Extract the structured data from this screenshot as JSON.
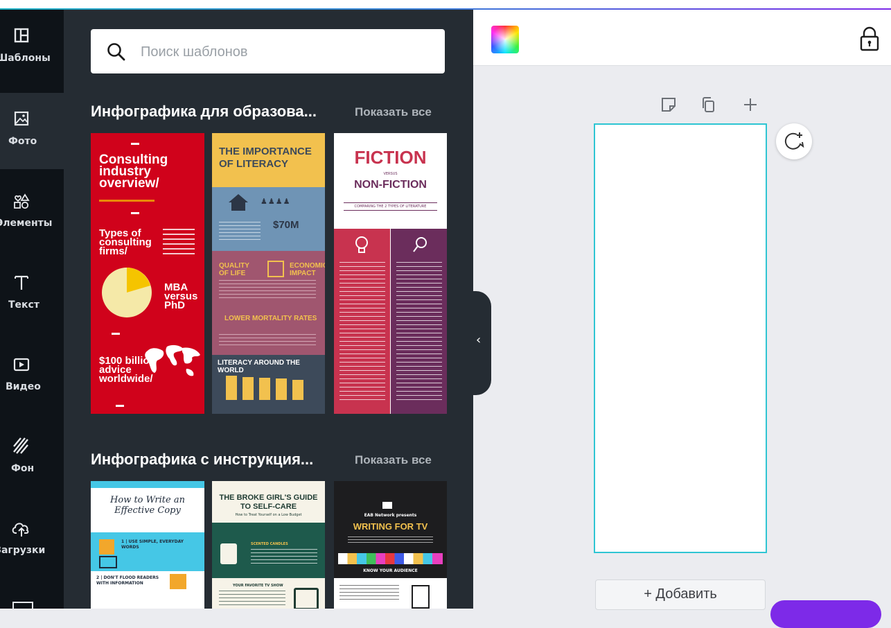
{
  "rail": {
    "items": [
      {
        "label": "Шаблоны",
        "icon": "templates-icon"
      },
      {
        "label": "Фото",
        "icon": "photo-icon"
      },
      {
        "label": "Элементы",
        "icon": "elements-icon"
      },
      {
        "label": "Текст",
        "icon": "text-icon"
      },
      {
        "label": "Видео",
        "icon": "video-icon"
      },
      {
        "label": "Фон",
        "icon": "background-icon"
      },
      {
        "label": "Загрузки",
        "icon": "upload-icon"
      }
    ]
  },
  "search": {
    "placeholder": "Поиск шаблонов"
  },
  "sections": [
    {
      "title": "Инфографика для образова...",
      "show_all": "Показать все",
      "templates": [
        {
          "name": "consulting",
          "title": "Consulting industry overview/",
          "subtitle": "Types of consulting firms/",
          "chart_label": "MBA versus PhD",
          "stat": "$100 billion advice worldwide/",
          "colors": {
            "bg": "#d0021b",
            "accent": "#f5c400"
          }
        },
        {
          "name": "literacy",
          "title": "THE IMPORTANCE OF LITERACY",
          "stat": "$70M",
          "quality": "QUALITY OF LIFE",
          "economic": "ECONOMIC IMPACT",
          "mortality": "LOWER MORTALITY RATES",
          "around": "LITERACY AROUND THE WORLD",
          "colors": {
            "yellow": "#f2c14e",
            "blue": "#6f94b5",
            "mauve": "#a0566f",
            "slate": "#3d4a5a"
          }
        },
        {
          "name": "fiction",
          "title": "FICTION",
          "versus": "VERSUS",
          "subtitle": "NON-FICTION",
          "caption": "COMPARING THE 2 TYPES OF LITERATURE",
          "colors": {
            "red": "#c8334f",
            "purple": "#6b2d5c"
          }
        }
      ]
    },
    {
      "title": "Инфографика с инструкция...",
      "show_all": "Показать все",
      "templates": [
        {
          "name": "effective-copy",
          "title": "How to Write an Effective Copy",
          "point": "1 | USE SIMPLE, EVERYDAY WORDS",
          "point2": "2 | DON'T FLOOD READERS WITH INFORMATION"
        },
        {
          "name": "self-care",
          "title": "THE BROKE GIRL'S GUIDE TO SELF-CARE",
          "subtitle": "How to Treat Yourself on a Low Budget",
          "point": "SCENTED CANDLES",
          "point2": "YOUR FAVORITE TV SHOW"
        },
        {
          "name": "writing-tv",
          "kicker": "EAB Network presents",
          "title": "WRITING FOR TV",
          "section": "KNOW YOUR AUDIENCE"
        }
      ]
    }
  ],
  "collapse": {
    "icon": "chevron-left-icon"
  },
  "editor": {
    "color_icon": "color-picker-icon",
    "lock_icon": "lock-icon",
    "page_tools": [
      "note-icon",
      "duplicate-page-icon",
      "add-page-icon"
    ],
    "comment_icon": "add-comment-icon",
    "add_page_label": "+ Добавить"
  }
}
